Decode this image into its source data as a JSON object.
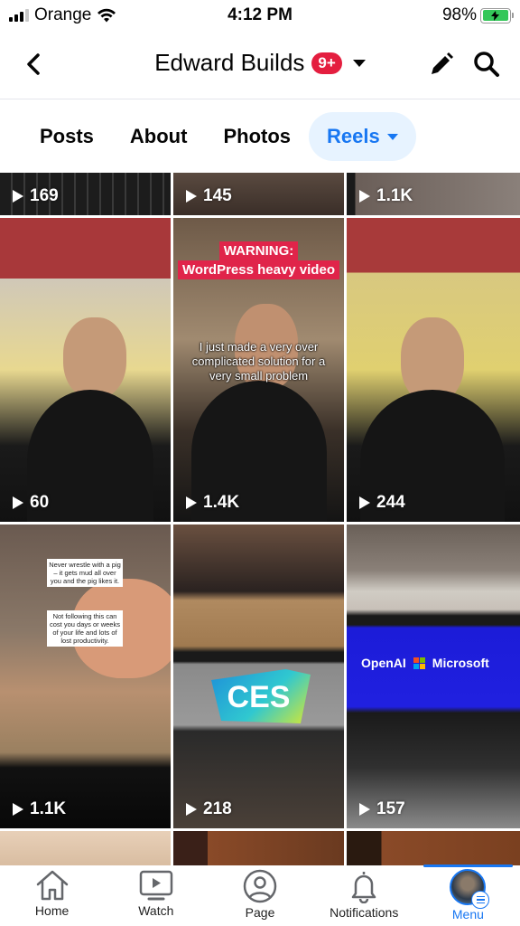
{
  "status_bar": {
    "carrier": "Orange",
    "time": "4:12 PM",
    "battery": "98%",
    "battery_level": 0.98
  },
  "header": {
    "title": "Edward Builds",
    "notification_badge": "9+",
    "icons": {
      "back": "chevron-left-icon",
      "edit": "pencil-icon",
      "search": "search-icon"
    }
  },
  "tabs": [
    {
      "label": "Posts",
      "active": false
    },
    {
      "label": "About",
      "active": false
    },
    {
      "label": "Photos",
      "active": false
    },
    {
      "label": "Reels",
      "active": true
    }
  ],
  "reels": [
    {
      "views": "169",
      "overlay": []
    },
    {
      "views": "145",
      "overlay": []
    },
    {
      "views": "1.1K",
      "overlay": []
    },
    {
      "views": "60",
      "overlay": []
    },
    {
      "views": "1.4K",
      "overlay": [
        "WARNING:",
        "WordPress heavy video",
        "I just made a very over complicated solution for a very small problem"
      ]
    },
    {
      "views": "244",
      "overlay": []
    },
    {
      "views": "1.1K",
      "overlay": [
        "Never wrestle with a pig – it gets mud all over you and the pig likes it.",
        "Not following this can cost you days or weeks of your life and lots of lost productivity."
      ]
    },
    {
      "views": "218",
      "overlay": [
        "CES"
      ]
    },
    {
      "views": "157",
      "overlay": [
        "OpenAI",
        "Microsoft"
      ]
    }
  ],
  "bottom_nav": [
    {
      "label": "Home",
      "icon": "home-icon",
      "active": false
    },
    {
      "label": "Watch",
      "icon": "video-play-icon",
      "active": false
    },
    {
      "label": "Page",
      "icon": "profile-circle-icon",
      "active": false
    },
    {
      "label": "Notifications",
      "icon": "bell-icon",
      "active": false
    },
    {
      "label": "Menu",
      "icon": "avatar-menu-icon",
      "active": true
    }
  ],
  "colors": {
    "accent": "#1877f2",
    "badge": "#e41e3f",
    "active_tab_bg": "#e7f3ff"
  }
}
